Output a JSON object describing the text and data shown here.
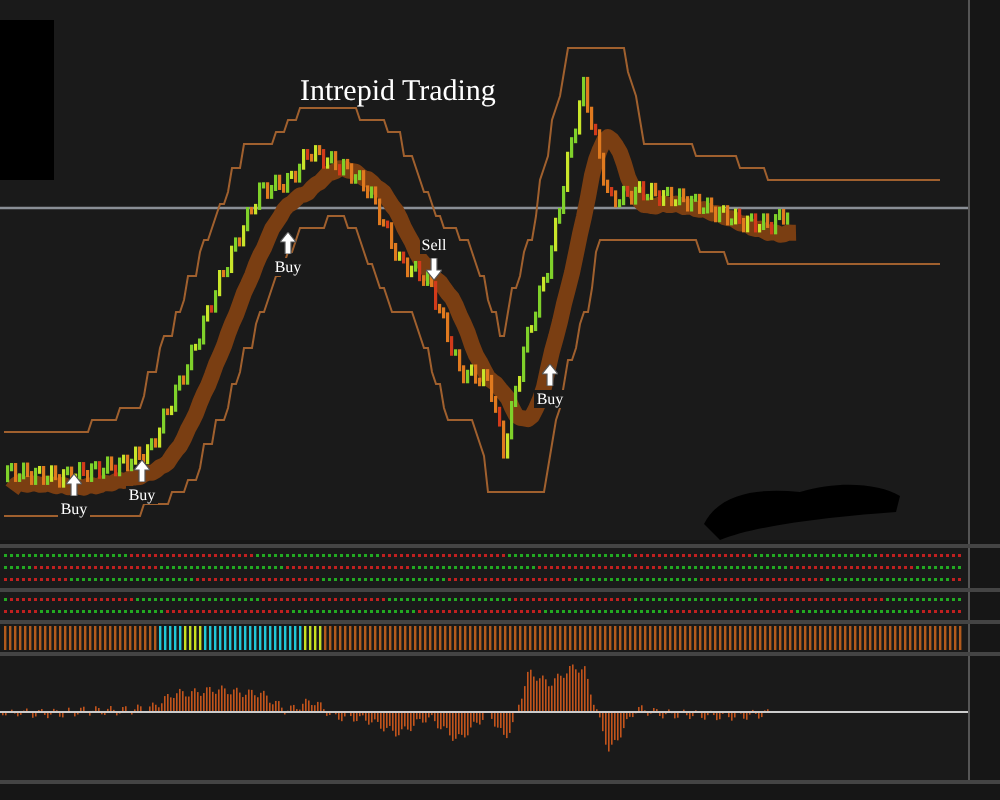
{
  "chart": {
    "title": "Intrepid Trading",
    "signals": [
      {
        "label": "Buy",
        "kind": "buy"
      },
      {
        "label": "Buy",
        "kind": "buy"
      },
      {
        "label": "Buy",
        "kind": "buy"
      },
      {
        "label": "Sell",
        "kind": "sell"
      },
      {
        "label": "Buy",
        "kind": "buy"
      }
    ]
  }
}
